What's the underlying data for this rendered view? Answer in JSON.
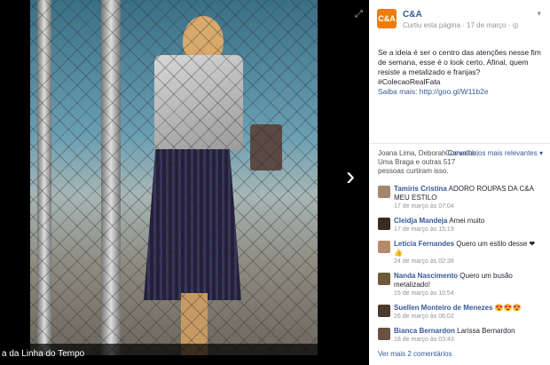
{
  "viewer": {
    "caption": "a da Linha do Tempo",
    "next_arrow": "›",
    "expand_icon": "⤢"
  },
  "post": {
    "page_name": "C&A",
    "avatar_text": "C&A",
    "meta": "Curtiu esta página · 17 de março · ◎",
    "text": "Se a ideia é ser o centro das atenções nesse fim de semana, esse é o look certo. Afinal, quem resiste a metalizado e franjas? #ColecaoRealFata",
    "link": "Saiba mais: http://goo.gl/W11b2e",
    "likes_text": "Joana Lima, Deborah Carvalho, Uma Braga e outras 517 pessoas curtiram isso.",
    "sort_label": "Comentários mais relevantes ▾"
  },
  "comments": [
    {
      "name": "Tamiris Cristina",
      "text": "ADORO ROUPAS DA C&A MEU ESTILO",
      "time": "17 de março às 07:04",
      "avatar": "#a08870"
    },
    {
      "name": "Cleidja Mandeja",
      "text": "Amei muito",
      "time": "17 de março às 15:19",
      "avatar": "#3a2a22"
    },
    {
      "name": "Letícia Fernandes",
      "text": "Quero um estilo desse ❤👍",
      "time": "24 de março às 02:38",
      "avatar": "#b58a6a"
    },
    {
      "name": "Nanda Nascimento",
      "text": "Quero um busão metalizado!",
      "time": "15 de março às 10:54",
      "avatar": "#6e5a3a"
    },
    {
      "name": "Suellen Monteiro de Menezes",
      "text": "😍😍😍",
      "time": "26 de março às 06:02",
      "avatar": "#4a3a2e"
    },
    {
      "name": "Bianca Bernardon",
      "text": "Larissa Bernardon",
      "time": "18 de março às 03:43",
      "avatar": "#6b5044"
    }
  ],
  "more_comments": "Ver mais 2 comentários"
}
